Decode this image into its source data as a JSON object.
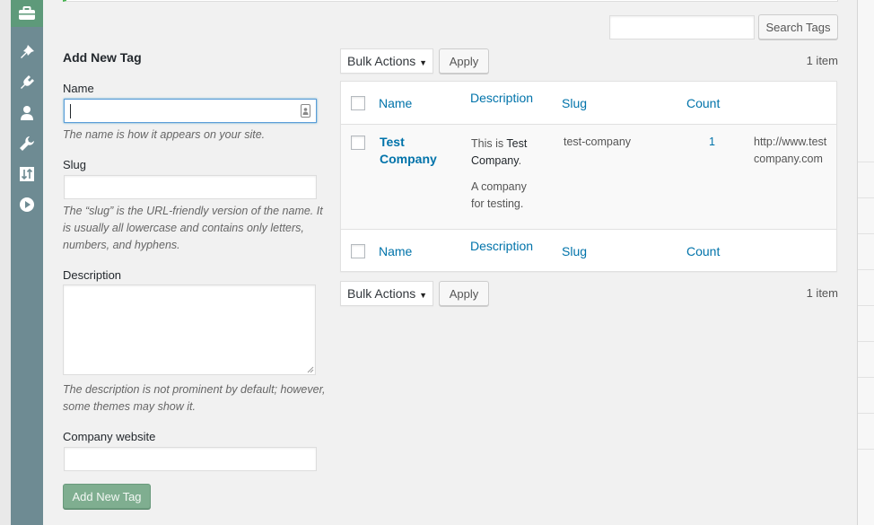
{
  "sidebar": {
    "icons": [
      "briefcase-icon",
      "pin-icon",
      "plugin-icon",
      "user-icon",
      "wrench-icon",
      "sort-icon",
      "play-icon"
    ]
  },
  "search": {
    "input_value": "",
    "button_label": "Search Tags"
  },
  "form": {
    "title": "Add New Tag",
    "name_label": "Name",
    "name_value": "",
    "name_help": "The name is how it appears on your site.",
    "slug_label": "Slug",
    "slug_value": "",
    "slug_help": "The “slug” is the URL-friendly version of the name. It is usually all lowercase and contains only letters, numbers, and hyphens.",
    "description_label": "Description",
    "description_value": "",
    "description_help": "The description is not prominent by default; however, some themes may show it.",
    "website_label": "Company website",
    "website_value": "",
    "submit_label": "Add New Tag"
  },
  "bulk_top": {
    "select_label": "Bulk Actions",
    "apply_label": "Apply",
    "count": "1 item"
  },
  "bulk_bottom": {
    "select_label": "Bulk Actions",
    "apply_label": "Apply",
    "count": "1 item"
  },
  "table": {
    "columns": [
      "Name",
      "Description",
      "Slug",
      "Count"
    ],
    "rows": [
      {
        "name": "Test Company",
        "description_prefix": "This is ",
        "description_bold": "Test Company",
        "description_suffix": ".",
        "description_line2": "A company for testing.",
        "slug": "test-company",
        "count": "1",
        "website": "http://www.testcompany.com"
      }
    ]
  },
  "colors": {
    "accent_link": "#0073aa",
    "sidebar": "#6e8b93",
    "submit_button": "#7fae90"
  }
}
